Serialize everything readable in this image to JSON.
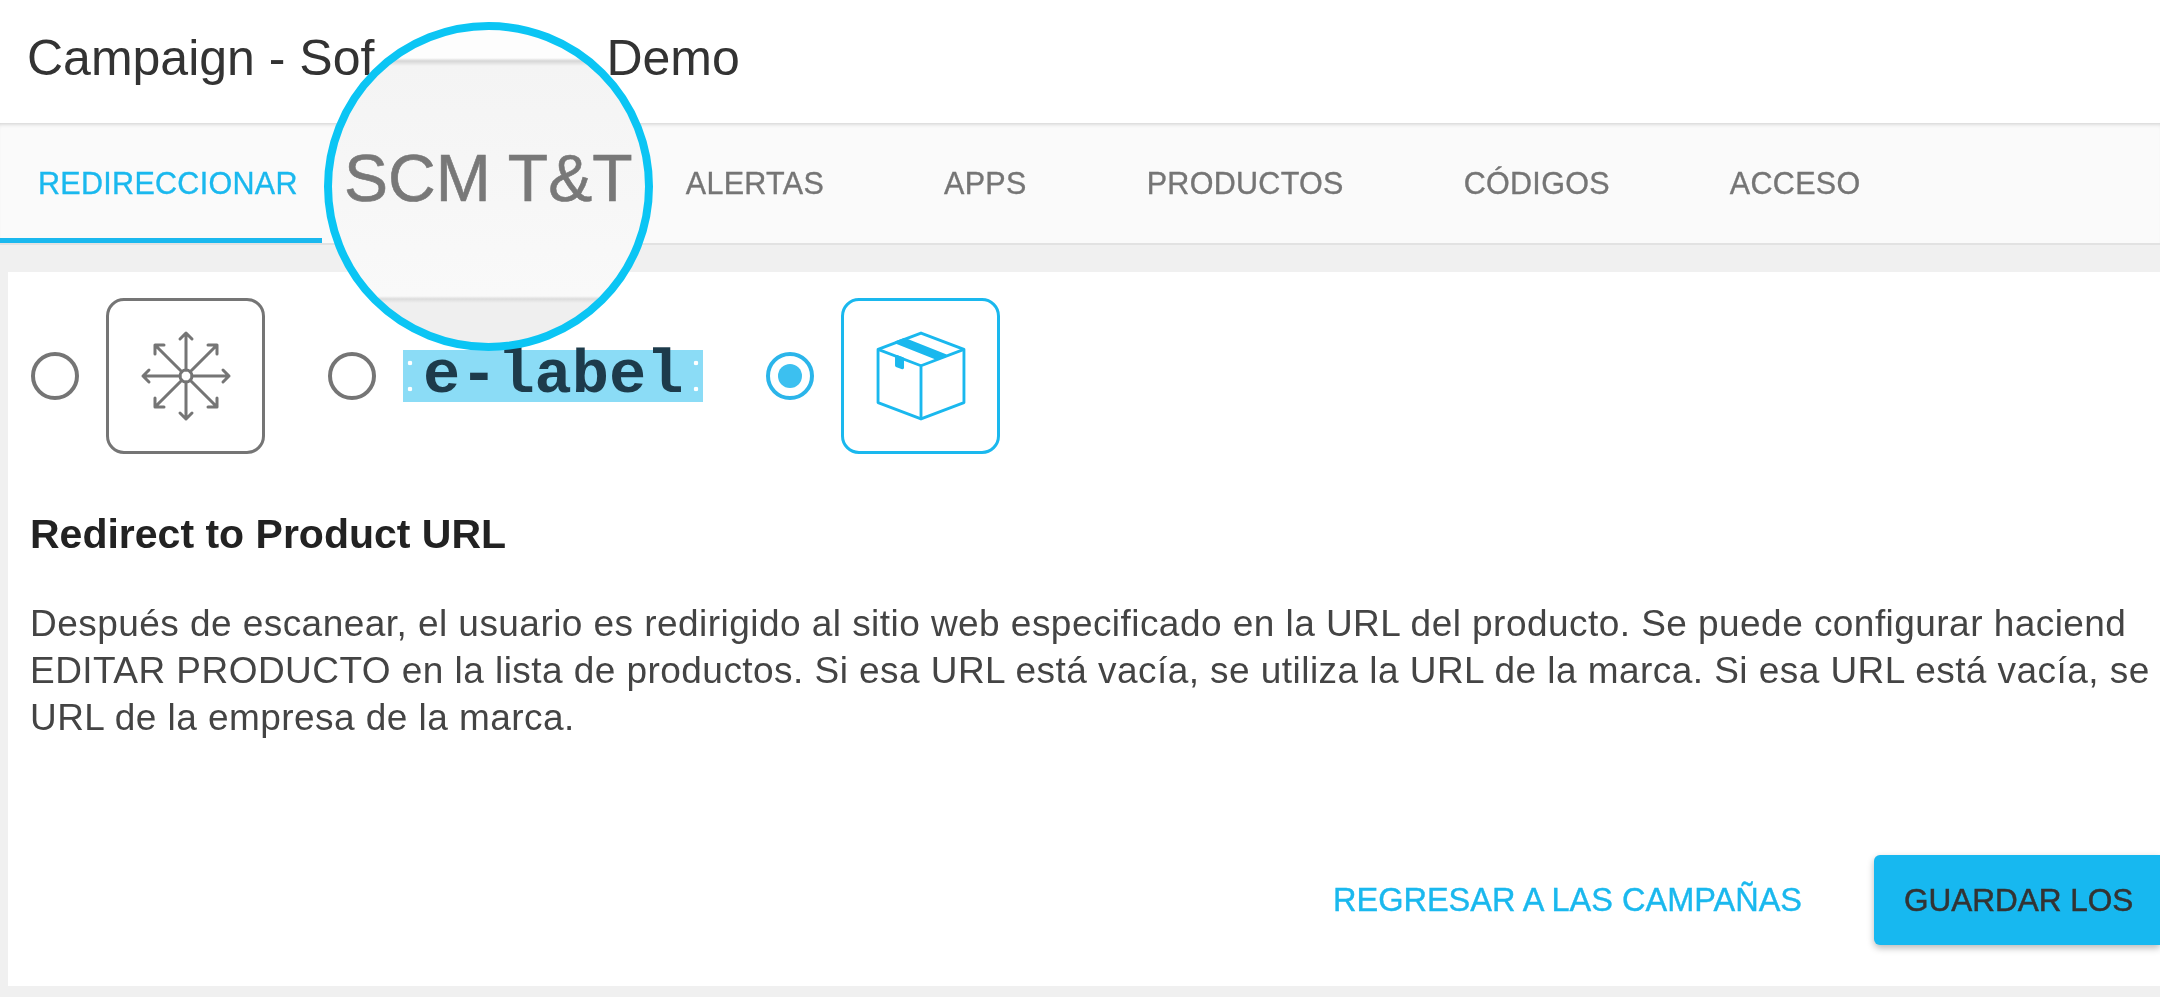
{
  "window": {
    "title_start": "Campaign - Sof",
    "title_end": "Demo"
  },
  "tabs": [
    {
      "label": "REDIRECCIONAR",
      "selected": true,
      "magnified": false
    },
    {
      "label": "SCM T&T",
      "selected": false,
      "magnified": true
    },
    {
      "label": "ALERTAS",
      "selected": false,
      "magnified": false
    },
    {
      "label": "APPS",
      "selected": false,
      "magnified": false
    },
    {
      "label": "PRODUCTOS",
      "selected": false,
      "magnified": false
    },
    {
      "label": "CÓDIGOS",
      "selected": false,
      "magnified": false
    },
    {
      "label": "ACCESO",
      "selected": false,
      "magnified": false
    }
  ],
  "options": [
    {
      "kind": "tile",
      "selected": false
    },
    {
      "kind": "logo",
      "text": "e-label",
      "selected": false
    },
    {
      "kind": "tile",
      "selected": true
    }
  ],
  "description": {
    "heading": "Redirect to Product URL",
    "lines": [
      "Después de escanear, el usuario es redirigido al sitio web especificado en la URL del producto. Se puede configurar haciend",
      "EDITAR PRODUCTO en la lista de productos. Si esa URL está vacía, se utiliza la URL de la marca. Si esa URL está vacía, se",
      "URL de la empresa de la marca."
    ]
  },
  "actions": [
    {
      "kind": "text",
      "label": "REGRESAR A LAS CAMPAÑAS"
    },
    {
      "kind": "raised",
      "label": "GUARDAR LOS"
    }
  ]
}
